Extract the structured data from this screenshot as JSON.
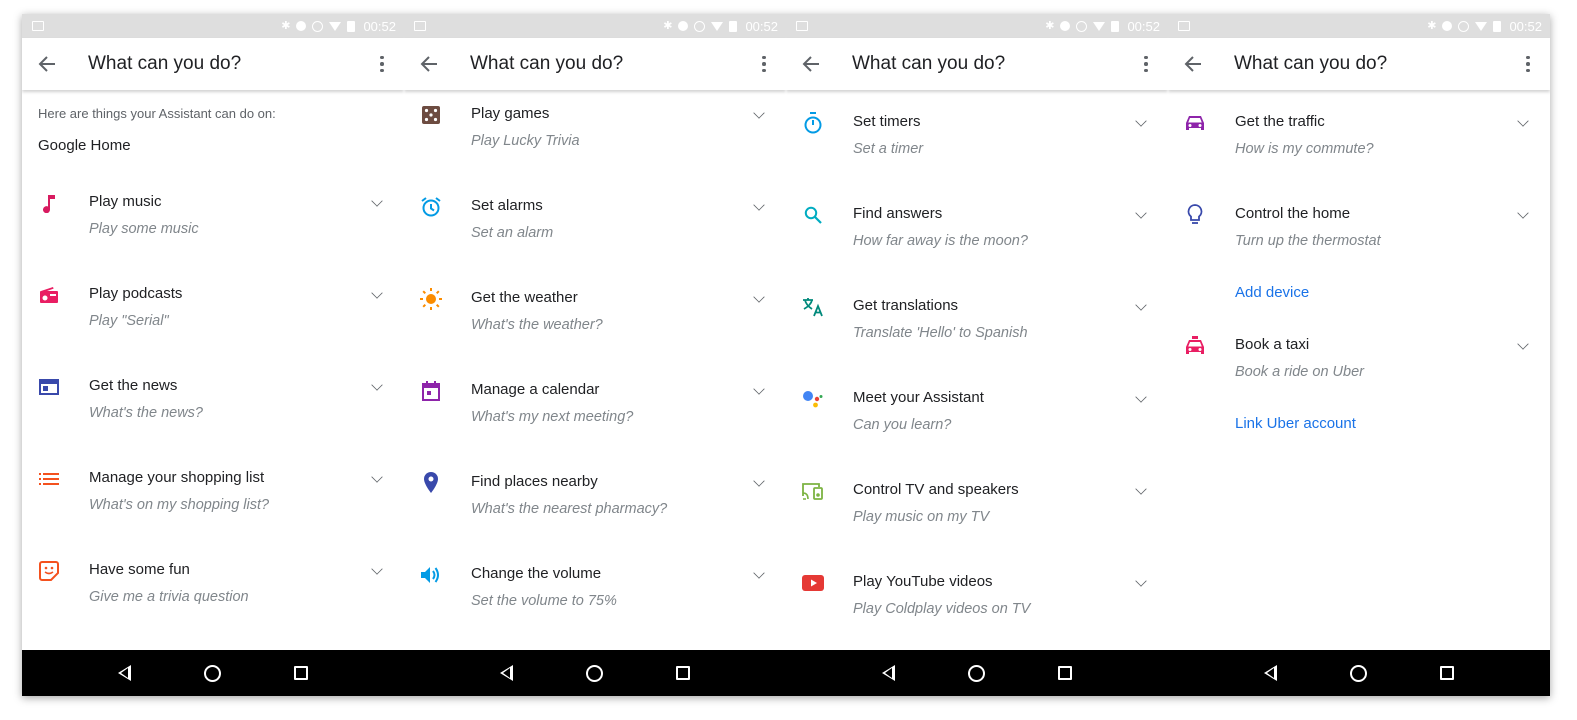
{
  "status": {
    "time": "00:52"
  },
  "screens": [
    {
      "title": "What can you do?",
      "intro": "Here are things your Assistant can do on:",
      "device": "Google Home",
      "items": [
        {
          "label": "Play music",
          "sub": "Play some music",
          "icon": "music-note-icon",
          "color": "#d81b60"
        },
        {
          "label": "Play podcasts",
          "sub": "Play \"Serial\"",
          "icon": "radio-icon",
          "color": "#e91e63"
        },
        {
          "label": "Get the news",
          "sub": "What's the news?",
          "icon": "news-icon",
          "color": "#3949ab"
        },
        {
          "label": "Manage your shopping list",
          "sub": "What's on my shopping list?",
          "icon": "list-icon",
          "color": "#f4511e"
        },
        {
          "label": "Have some fun",
          "sub": "Give me a trivia question",
          "icon": "sticker-icon",
          "color": "#f4511e"
        }
      ]
    },
    {
      "title": "What can you do?",
      "items": [
        {
          "label": "Play games",
          "sub": "Play Lucky Trivia",
          "icon": "dice-icon",
          "color": "#6d4c41"
        },
        {
          "label": "Set alarms",
          "sub": "Set an alarm",
          "icon": "alarm-icon",
          "color": "#039be5"
        },
        {
          "label": "Get the weather",
          "sub": "What's the weather?",
          "icon": "sun-icon",
          "color": "#fb8c00"
        },
        {
          "label": "Manage a calendar",
          "sub": "What's my next meeting?",
          "icon": "calendar-icon",
          "color": "#8e24aa"
        },
        {
          "label": "Find places nearby",
          "sub": "What's the nearest pharmacy?",
          "icon": "place-icon",
          "color": "#3949ab"
        },
        {
          "label": "Change the volume",
          "sub": "Set the volume to 75%",
          "icon": "volume-icon",
          "color": "#039be5"
        }
      ]
    },
    {
      "title": "What can you do?",
      "items": [
        {
          "label": "Set timers",
          "sub": "Set a timer",
          "icon": "timer-icon",
          "color": "#039be5"
        },
        {
          "label": "Find answers",
          "sub": "How far away is the moon?",
          "icon": "search-icon",
          "color": "#00acc1"
        },
        {
          "label": "Get translations",
          "sub": "Translate 'Hello' to Spanish",
          "icon": "translate-icon",
          "color": "#00897b"
        },
        {
          "label": "Meet your Assistant",
          "sub": "Can you learn?",
          "icon": "assistant-icon",
          "color": "#4285f4"
        },
        {
          "label": "Control TV and speakers",
          "sub": "Play music on my TV",
          "icon": "cast-speaker-icon",
          "color": "#7cb342"
        },
        {
          "label": "Play YouTube videos",
          "sub": "Play Coldplay videos on TV",
          "icon": "youtube-icon",
          "color": "#e53935"
        }
      ]
    },
    {
      "title": "What can you do?",
      "items": [
        {
          "label": "Get the traffic",
          "sub": "How is my commute?",
          "icon": "car-icon",
          "color": "#8e24aa"
        },
        {
          "label": "Control the home",
          "sub": "Turn up the thermostat",
          "icon": "lightbulb-icon",
          "color": "#3949ab",
          "link": "Add device"
        },
        {
          "label": "Book a taxi",
          "sub": "Book a ride on Uber",
          "icon": "taxi-icon",
          "color": "#e91e63",
          "link": "Link Uber account"
        }
      ]
    }
  ]
}
